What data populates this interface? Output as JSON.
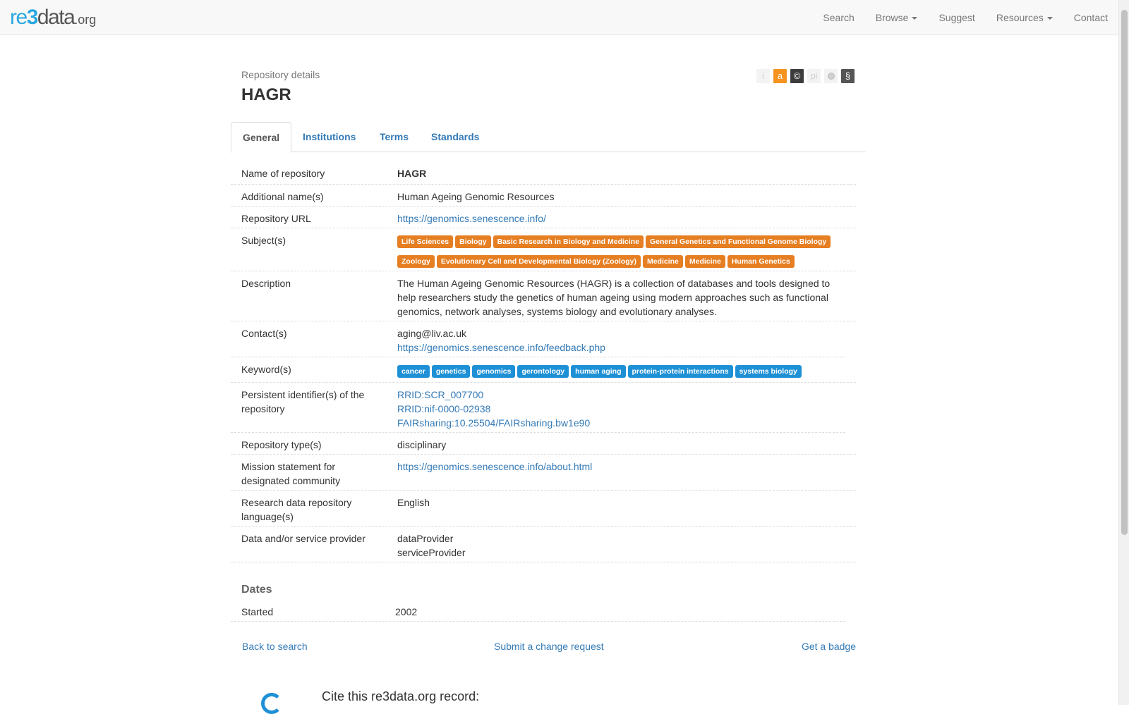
{
  "brand": {
    "re": "re",
    "three": "3",
    "data": "data",
    "org": ".org"
  },
  "nav": {
    "search": "Search",
    "browse": "Browse",
    "suggest": "Suggest",
    "resources": "Resources",
    "contact": "Contact"
  },
  "header": {
    "subtitle": "Repository details",
    "title": "HAGR",
    "icons": [
      {
        "name": "info-icon",
        "glyph": "i",
        "state": "inactive"
      },
      {
        "name": "open-access-icon",
        "glyph": "a",
        "state": "active",
        "color": "#f6921e"
      },
      {
        "name": "copyright-icon",
        "glyph": "©",
        "state": "active",
        "color": "#3c3c3c"
      },
      {
        "name": "persistent-identifier-icon",
        "glyph": "pi",
        "state": "inactive"
      },
      {
        "name": "certificate-icon",
        "glyph": "",
        "state": "inactive"
      },
      {
        "name": "policy-icon",
        "glyph": "§",
        "state": "active",
        "color": "#555555"
      }
    ]
  },
  "tabs": [
    "General",
    "Institutions",
    "Terms",
    "Standards"
  ],
  "details": {
    "name_label": "Name of repository",
    "name_value": "HAGR",
    "additional_label": "Additional name(s)",
    "additional_value": "Human Ageing Genomic Resources",
    "url_label": "Repository URL",
    "url_value": "https://genomics.senescence.info/",
    "subjects_label": "Subject(s)",
    "subjects": [
      "Life Sciences",
      "Biology",
      "Basic Research in Biology and Medicine",
      "General Genetics and Functional Genome Biology",
      "Zoology",
      "Evolutionary Cell and Developmental Biology (Zoology)",
      "Medicine",
      "Medicine",
      "Human Genetics"
    ],
    "description_label": "Description",
    "description_value": "The Human Ageing Genomic Resources (HAGR) is a collection of databases and tools designed to help researchers study the genetics of human ageing using modern approaches such as functional genomics, network analyses, systems biology and evolutionary analyses.",
    "contacts_label": "Contact(s)",
    "contact_email": "aging@liv.ac.uk",
    "contact_url": "https://genomics.senescence.info/feedback.php",
    "keywords_label": "Keyword(s)",
    "keywords": [
      "cancer",
      "genetics",
      "genomics",
      "gerontology",
      "human aging",
      "protein-protein interactions",
      "systems biology"
    ],
    "pid_label": "Persistent identifier(s) of the repository",
    "pids": [
      "RRID:SCR_007700",
      "RRID:nif-0000-02938",
      "FAIRsharing:10.25504/FAIRsharing.bw1e90"
    ],
    "type_label": "Repository type(s)",
    "type_value": "disciplinary",
    "mission_label": "Mission statement for designated community",
    "mission_value": "https://genomics.senescence.info/about.html",
    "language_label": "Research data repository language(s)",
    "language_value": "English",
    "provider_label": "Data and/or service provider",
    "provider_values": [
      "dataProvider",
      "serviceProvider"
    ]
  },
  "dates": {
    "title": "Dates",
    "started_label": "Started",
    "started_value": "2002"
  },
  "footer_links": {
    "back": "Back to search",
    "change": "Submit a change request",
    "badge": "Get a badge"
  },
  "cite": {
    "title": "Cite this re3data.org record:"
  }
}
